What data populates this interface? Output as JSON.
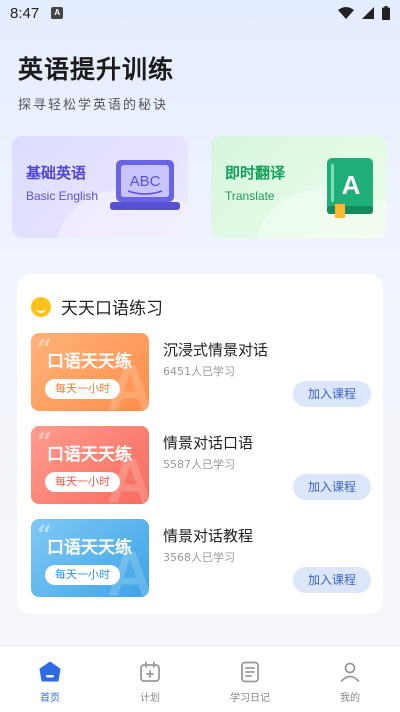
{
  "status_bar": {
    "time": "8:47",
    "app_badge": "A"
  },
  "header": {
    "title": "英语提升训练",
    "subtitle": "探寻轻松学英语的秘诀"
  },
  "feature_cards": [
    {
      "title": "基础英语",
      "subtitle": "Basic English",
      "illustration_text": "ABC"
    },
    {
      "title": "即时翻译",
      "subtitle": "Translate",
      "illustration_text": "A"
    }
  ],
  "course_section": {
    "title": "天天口语练习",
    "courses": [
      {
        "thumb_title": "口语天天练",
        "thumb_tag": "每天一小时",
        "name": "沉浸式情景对话",
        "learners": "6451人已学习",
        "button": "加入课程"
      },
      {
        "thumb_title": "口语天天练",
        "thumb_tag": "每天一小时",
        "name": "情景对话口语",
        "learners": "5587人已学习",
        "button": "加入课程"
      },
      {
        "thumb_title": "口语天天练",
        "thumb_tag": "每天一小时",
        "name": "情景对话教程",
        "learners": "3568人已学习",
        "button": "加入课程"
      }
    ]
  },
  "tab_bar": {
    "tabs": [
      {
        "label": "首页",
        "icon": "home-icon",
        "active": true
      },
      {
        "label": "计划",
        "icon": "calendar-plan-icon",
        "active": false
      },
      {
        "label": "学习日记",
        "icon": "diary-icon",
        "active": false
      },
      {
        "label": "我的",
        "icon": "profile-icon",
        "active": false
      }
    ]
  },
  "colors": {
    "accent": "#2f6be6",
    "join_bg": "#dce6fb",
    "join_text": "#3b63c9"
  }
}
